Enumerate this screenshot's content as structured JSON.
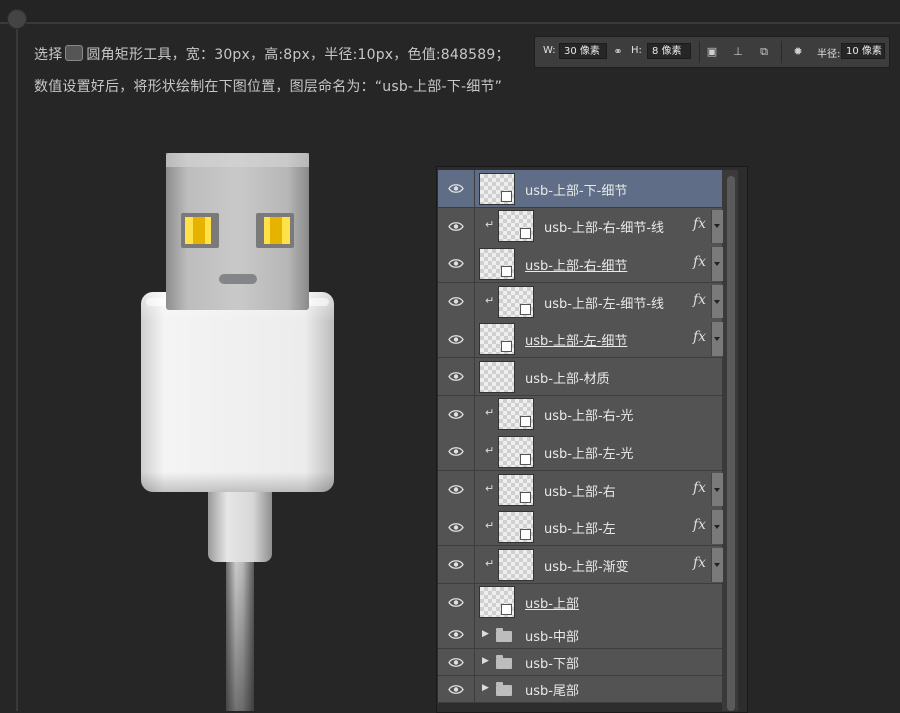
{
  "instructions": {
    "line1_prefix": "选择",
    "line1_suffix": "圆角矩形工具，宽：30px，高:8px，半径:10px，色值:848589；",
    "line2": "数值设置好后，将形状绘制在下图位置，图层命名为：“usb-上部-下-细节”",
    "tool_icon": "rounded-rectangle-tool-icon"
  },
  "options_bar": {
    "w_label": "W:",
    "w_value": "30 像素",
    "link_icon": "link-icon",
    "h_label": "H:",
    "h_value": "8 像素",
    "path_ops_icon": "path-operations-icon",
    "align_icon": "path-alignment-icon",
    "arrange_icon": "path-arrangement-icon",
    "gear_icon": "gear-icon",
    "radius_label": "半径:",
    "radius_value": "10 像素"
  },
  "layers_panel": {
    "layers": [
      {
        "name": "usb-上部-下-细节",
        "selected": true,
        "clipped": false,
        "fx": false,
        "underline": false,
        "kind": "shape"
      },
      {
        "name": "usb-上部-右-细节-线",
        "selected": false,
        "clipped": true,
        "fx": true,
        "underline": false,
        "kind": "shape"
      },
      {
        "name": "usb-上部-右-细节",
        "selected": false,
        "clipped": false,
        "fx": true,
        "underline": true,
        "kind": "shape"
      },
      {
        "name": "usb-上部-左-细节-线",
        "selected": false,
        "clipped": true,
        "fx": true,
        "underline": false,
        "kind": "shape"
      },
      {
        "name": "usb-上部-左-细节",
        "selected": false,
        "clipped": false,
        "fx": true,
        "underline": true,
        "kind": "shape"
      },
      {
        "name": "usb-上部-材质",
        "selected": false,
        "clipped": false,
        "fx": false,
        "underline": false,
        "kind": "pixel"
      },
      {
        "name": "usb-上部-右-光",
        "selected": false,
        "clipped": true,
        "fx": false,
        "underline": false,
        "kind": "shape"
      },
      {
        "name": "usb-上部-左-光",
        "selected": false,
        "clipped": true,
        "fx": false,
        "underline": false,
        "kind": "shape"
      },
      {
        "name": "usb-上部-右",
        "selected": false,
        "clipped": true,
        "fx": true,
        "underline": false,
        "kind": "shape"
      },
      {
        "name": "usb-上部-左",
        "selected": false,
        "clipped": true,
        "fx": true,
        "underline": false,
        "kind": "shape"
      },
      {
        "name": "usb-上部-渐变",
        "selected": false,
        "clipped": true,
        "fx": true,
        "underline": false,
        "kind": "pixel"
      },
      {
        "name": "usb-上部",
        "selected": false,
        "clipped": false,
        "fx": false,
        "underline": true,
        "kind": "shape"
      }
    ],
    "groups": [
      {
        "name": "usb-中部"
      },
      {
        "name": "usb-下部"
      },
      {
        "name": "usb-尾部"
      }
    ],
    "fx_symbol": "fx",
    "clip_symbol": "↵"
  },
  "colors": {
    "selected_layer": "#5f6e86",
    "shape_fill": "#848589"
  }
}
